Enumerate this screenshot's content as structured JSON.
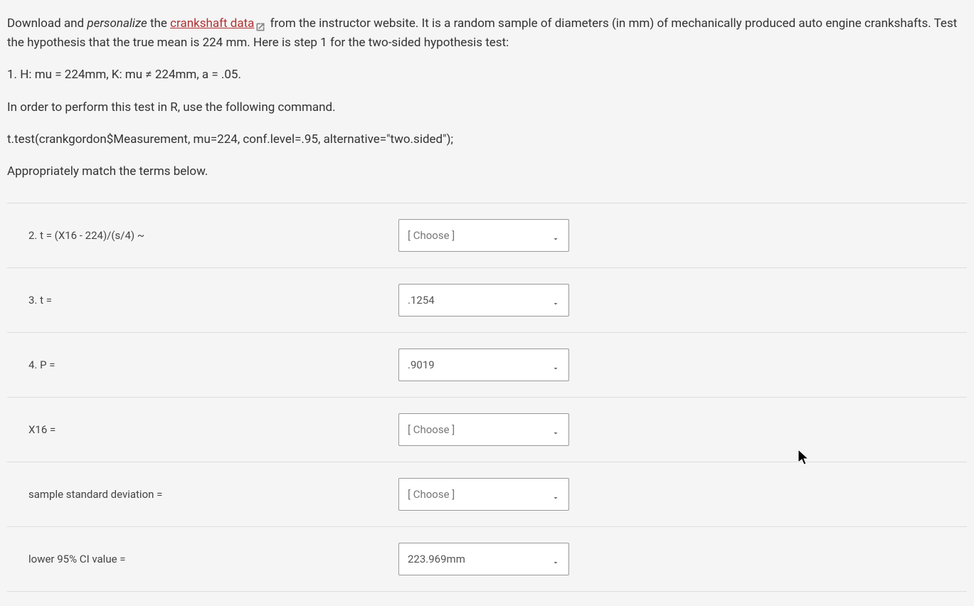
{
  "intro": {
    "part1": "Download and ",
    "personalize": "personalize",
    "part2": " the ",
    "link_text": "crankshaft data",
    "part3": " from the instructor website. It is a random sample of diameters (in mm) of mechanically produced auto engine crankshafts.  Test the hypothesis that the true mean is 224 mm. Here is step 1 for the two-sided hypothesis test:"
  },
  "step1": "1. H: mu = 224mm, K: mu ≠ 224mm, a = .05.",
  "instruction1": "In order to perform this test in R, use the following command.",
  "r_command": "t.test(crankgordon$Measurement, mu=224, conf.level=.95, alternative=\"two.sided\");",
  "instruction2": "Appropriately  match the terms below.",
  "rows": [
    {
      "label": "2. t = (X16 - 224)/(s/4) ~",
      "value": "[ Choose ]",
      "placeholder": true
    },
    {
      "label": "3. t =",
      "value": ".1254",
      "placeholder": false
    },
    {
      "label": "4. P =",
      "value": ".9019",
      "placeholder": false
    },
    {
      "label": "X16 =",
      "value": "[ Choose ]",
      "placeholder": true
    },
    {
      "label": "sample standard deviation =",
      "value": "[ Choose ]",
      "placeholder": true
    },
    {
      "label": "lower 95% CI value =",
      "value": "223.969mm",
      "placeholder": false
    }
  ]
}
